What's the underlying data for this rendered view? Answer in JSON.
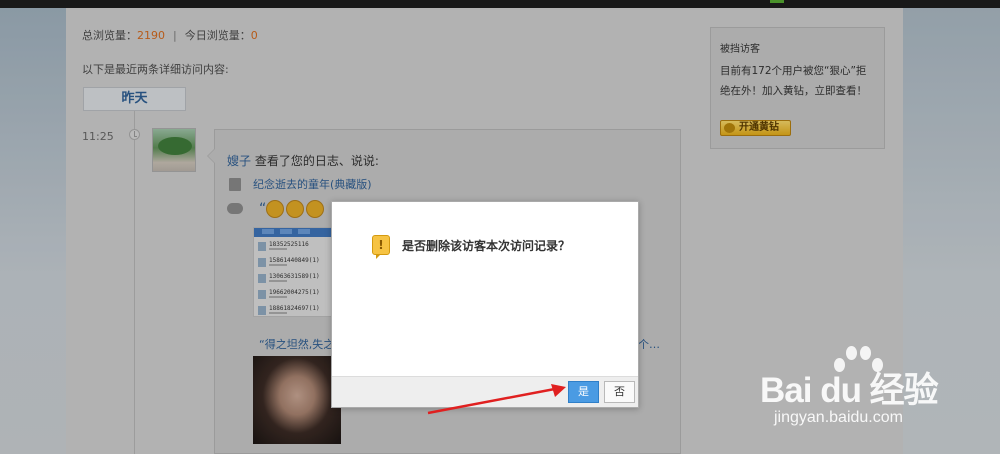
{
  "header": {
    "total_label": "总浏览量：",
    "total_value": "2190",
    "separator": "|",
    "today_label": "今日浏览量：",
    "today_value": "0"
  },
  "intro_text": "以下是最近两条详细访问内容:",
  "date_tab": "昨天",
  "visit": {
    "time": "11:25",
    "user_name": "嫂子",
    "action_text": "查看了您的日志、说说:",
    "blog_title": "纪念逝去的童年(典藏版)",
    "quote_open": "“",
    "quote2_text": "“得之坦然,失之",
    "quote2_suffix": "个…"
  },
  "phone_screenshot": {
    "numbers": [
      "18352525116",
      "15861440849(1)",
      "13063631589(1)",
      "19662004275(1)",
      "18861824697(1)"
    ]
  },
  "sidebar": {
    "title": "被挡访客",
    "description": "目前有172个用户被您“狠心”拒绝在外！加入黄钻，立即查看！",
    "vip_button": "开通黄钻"
  },
  "dialog": {
    "message": "是否删除该访客本次访问记录？",
    "warn_symbol": "!",
    "yes_label": "是",
    "no_label": "否"
  },
  "watermark": {
    "main": "Bai du 经验",
    "sub": "jingyan.baidu.com"
  },
  "colors": {
    "accent_blue": "#2d5d92",
    "number_orange": "#d2691e",
    "primary_button": "#4a9be3",
    "vip_gold": "#e2ab1a"
  },
  "icons": [
    "clock-icon",
    "blog-icon",
    "comment-icon",
    "emoji-icon",
    "warning-icon",
    "vip-diamond-icon",
    "baidu-paw-icon"
  ]
}
